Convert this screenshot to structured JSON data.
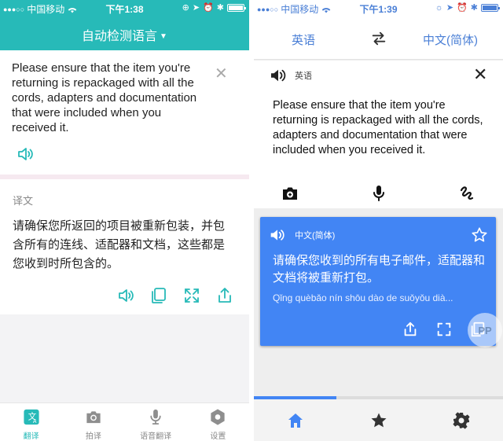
{
  "left_app": {
    "status_bar": {
      "signal": "●●●○○",
      "carrier": "中国移动",
      "time": "下午1:38"
    },
    "header": {
      "title": "自动检测语言",
      "accent_color": "#27bab8"
    },
    "source": {
      "text": "Please ensure that the item you're returning is repackaged with all the cords, adapters and documentation that were included when you received it."
    },
    "result": {
      "label": "译文",
      "text": "请确保您所返回的项目被重新包装，并包含所有的连线、适配器和文档，这些都是您收到时所包含的。"
    },
    "action_icons": [
      "speaker-icon",
      "copy-icon",
      "fullscreen-icon",
      "share-icon"
    ],
    "tabs": [
      {
        "label": "翻译",
        "icon": "translate-icon",
        "active": true
      },
      {
        "label": "拍译",
        "icon": "camera-icon",
        "active": false
      },
      {
        "label": "语音翻译",
        "icon": "microphone-icon",
        "active": false
      },
      {
        "label": "设置",
        "icon": "gear-icon",
        "active": false
      }
    ]
  },
  "right_app": {
    "status_bar": {
      "signal": "●●●○○",
      "carrier": "中国移动",
      "time": "下午1:39"
    },
    "languages": {
      "source": "英语",
      "target": "中文(简体)",
      "accent_color": "#4285f4"
    },
    "source": {
      "lang_label": "英语",
      "text": "Please ensure that the item you're returning is repackaged with all the cords, adapters and documentation that were included when you received it."
    },
    "tools": [
      "camera-icon",
      "microphone-icon",
      "handwriting-icon"
    ],
    "result": {
      "lang_label": "中文(简体)",
      "text": "请确保您收到的所有电子邮件，适配器和文档将被重新打包。",
      "pinyin": "Qǐng quèbǎo nín shōu dào de suǒyǒu dià...",
      "card_color": "#4285f4"
    },
    "progress": 0.33,
    "tabs": [
      "home-icon",
      "star-icon",
      "gear-icon"
    ],
    "watermark": "PP"
  }
}
